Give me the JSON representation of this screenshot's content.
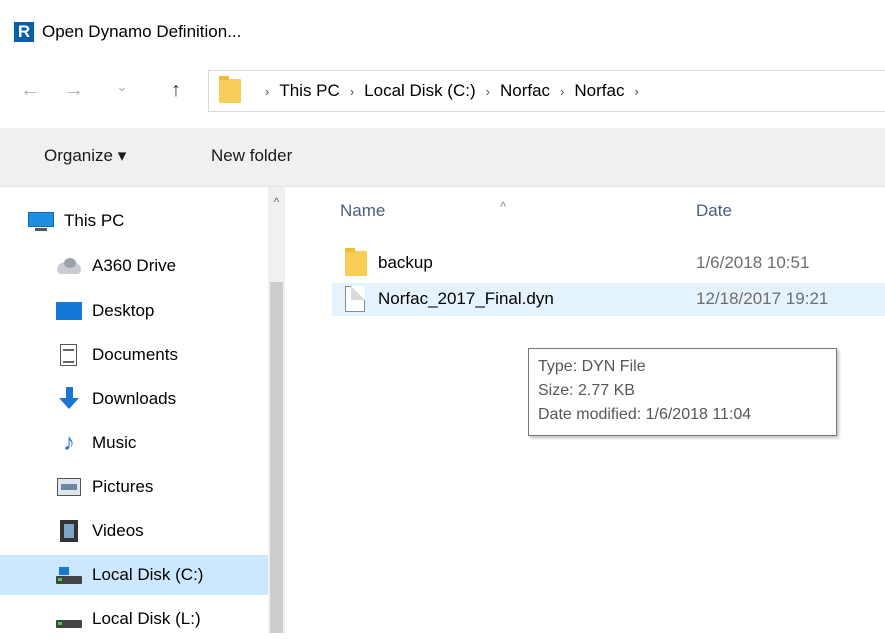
{
  "window": {
    "app_icon_letter": "R",
    "title": "Open Dynamo Definition..."
  },
  "nav_buttons": {
    "back": "←",
    "forward": "→",
    "recent": "⌄",
    "up": "↑"
  },
  "address": {
    "breadcrumbs": [
      "This PC",
      "Local Disk (C:)",
      "Norfac",
      "Norfac"
    ],
    "separator": "›"
  },
  "toolbar": {
    "organize_label": "Organize ▾",
    "new_folder_label": "New folder"
  },
  "sidebar": {
    "items": [
      {
        "label": "This PC",
        "icon": "computer-icon"
      },
      {
        "label": "A360 Drive",
        "icon": "cloud-drive-icon"
      },
      {
        "label": "Desktop",
        "icon": "desktop-icon"
      },
      {
        "label": "Documents",
        "icon": "documents-icon"
      },
      {
        "label": "Downloads",
        "icon": "downloads-icon"
      },
      {
        "label": "Music",
        "icon": "music-icon"
      },
      {
        "label": "Pictures",
        "icon": "pictures-icon"
      },
      {
        "label": "Videos",
        "icon": "videos-icon"
      },
      {
        "label": "Local Disk (C:)",
        "icon": "drive-icon",
        "selected": true
      },
      {
        "label": "Local Disk (L:)",
        "icon": "drive-icon"
      }
    ],
    "scroll_up": "^"
  },
  "file_list": {
    "columns": {
      "name": "Name",
      "date": "Date"
    },
    "sort_indicator": "^",
    "files": [
      {
        "name": "backup",
        "date": "1/6/2018 10:51",
        "type": "folder"
      },
      {
        "name": "Norfac_2017_Final.dyn",
        "date": "12/18/2017 19:21",
        "type": "file"
      }
    ]
  },
  "tooltip": {
    "type_line": "Type: DYN File",
    "size_line": "Size: 2.77 KB",
    "date_line": "Date modified: 1/6/2018 11:04"
  },
  "colors": {
    "selected_bg": "#cce8ff",
    "hover_bg": "#e5f3ff",
    "header_text": "#4c607a",
    "toolbar_bg": "#f0f0f0"
  }
}
